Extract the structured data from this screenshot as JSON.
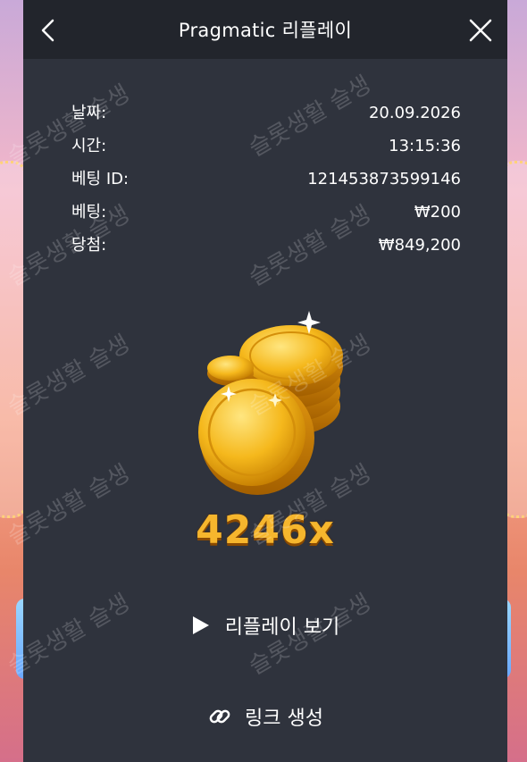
{
  "header": {
    "title": "Pragmatic 리플레이",
    "back_icon": "chevron-left-icon",
    "close_icon": "close-icon"
  },
  "details": [
    {
      "label": "날짜:",
      "value": "20.09.2026"
    },
    {
      "label": "시간:",
      "value": "13:15:36"
    },
    {
      "label": "베팅 ID:",
      "value": "121453873599146"
    },
    {
      "label": "베팅:",
      "value": "₩200"
    },
    {
      "label": "당첨:",
      "value": "₩849,200"
    }
  ],
  "result": {
    "image": "gold-coins-icon",
    "multiplier": "4246x"
  },
  "actions": {
    "replay_label": "리플레이 보기",
    "replay_icon": "play-icon",
    "link_label": "링크 생성",
    "link_icon": "link-icon"
  },
  "watermark": {
    "text": "슬롯생활 슬생"
  },
  "colors": {
    "modal_bg": "#2f333d",
    "header_bg": "#22252c",
    "multiplier": "#f6b62d",
    "text": "#ffffff"
  }
}
